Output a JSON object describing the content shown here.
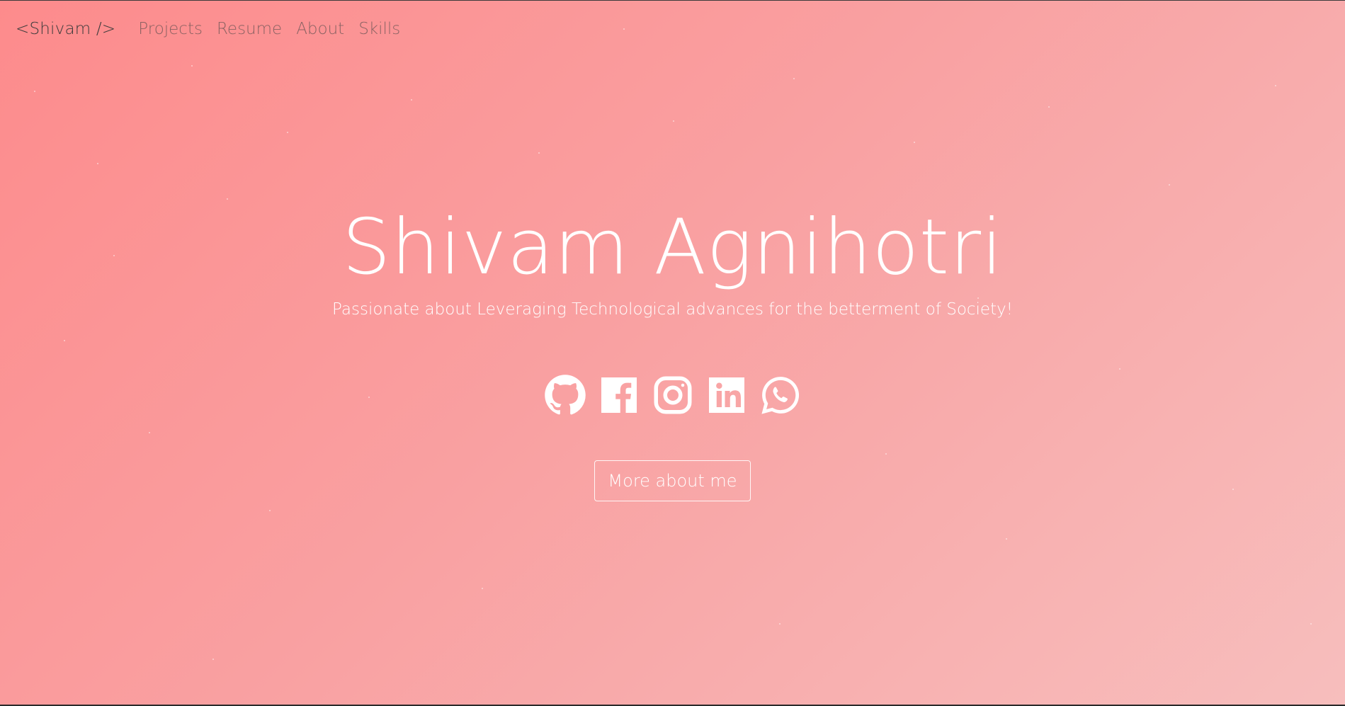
{
  "nav": {
    "brand": "<Shivam />",
    "links": [
      "Projects",
      "Resume",
      "About",
      "Skills"
    ]
  },
  "hero": {
    "title": "Shivam Agnihotri",
    "subtitle": "Passionate about Leveraging Technological advances for the betterment of Society!",
    "cta_label": "More about me"
  },
  "social": [
    {
      "icon": "github-icon"
    },
    {
      "icon": "facebook-icon"
    },
    {
      "icon": "instagram-icon"
    },
    {
      "icon": "linkedin-icon"
    },
    {
      "icon": "whatsapp-icon"
    }
  ],
  "colors": {
    "gradient_start": "#fd8b8c",
    "gradient_end": "#f7bebd",
    "text": "#ffffff",
    "brand_text": "#3b3b3b"
  }
}
